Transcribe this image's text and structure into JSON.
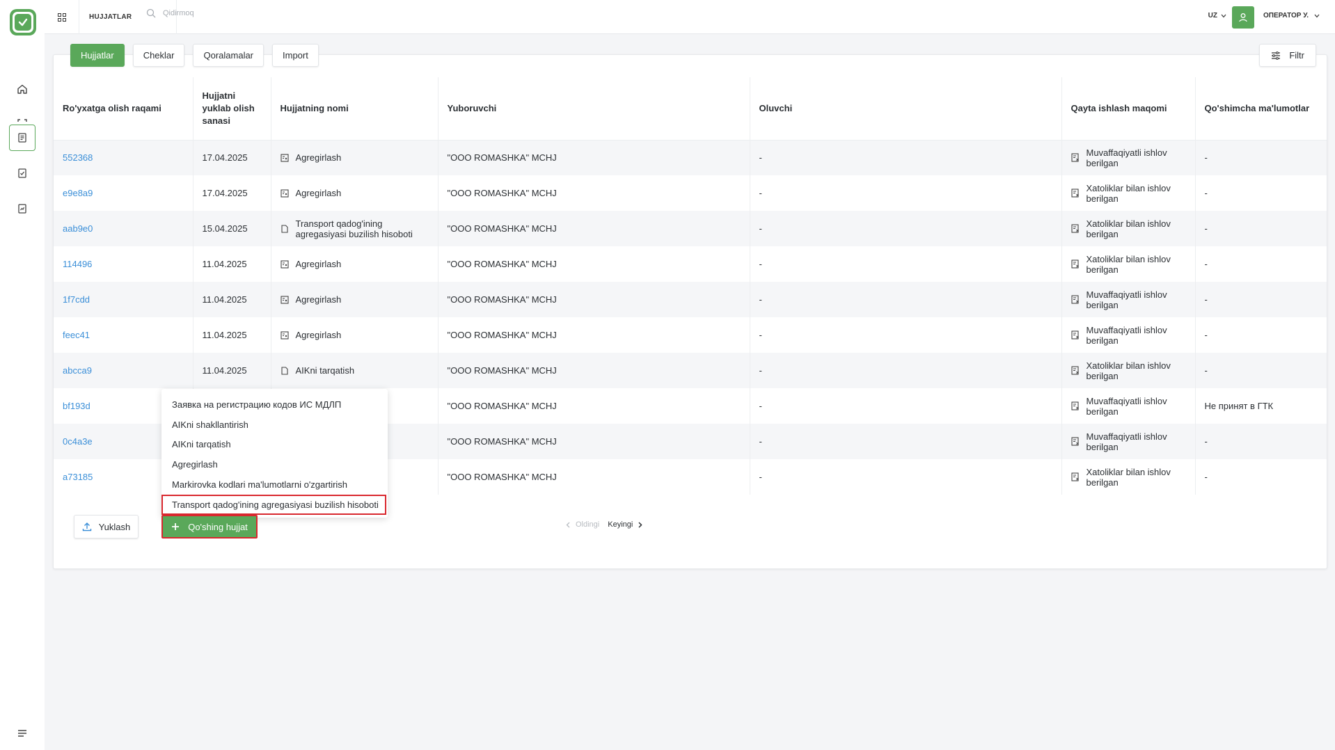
{
  "topbar": {
    "section_title": "HUJJATLAR",
    "search_placeholder": "Qidirmoq",
    "language": "UZ",
    "user_name": "ОПЕРАТОР У."
  },
  "tabs": [
    {
      "label": "Hujjatlar",
      "active": true
    },
    {
      "label": "Cheklar",
      "active": false
    },
    {
      "label": "Qoralamalar",
      "active": false
    },
    {
      "label": "Import",
      "active": false
    }
  ],
  "filter_label": "Filtr",
  "table": {
    "headers": [
      "Ro'yxatga olish raqami",
      "Hujjatni yuklab olish sanasi",
      "Hujjatning nomi",
      "Yuboruvchi",
      "Oluvchi",
      "Qayta ishlash maqomi",
      "Qo'shimcha ma'lumotlar"
    ],
    "rows": [
      {
        "id": "552368",
        "date": "17.04.2025",
        "name": "Agregirlash",
        "sender": "\"OOO ROMASHKA\" MCHJ",
        "receiver": "-",
        "status": "Muvaffaqiyatli ishlov berilgan",
        "extra": "-"
      },
      {
        "id": "e9e8a9",
        "date": "17.04.2025",
        "name": "Agregirlash",
        "sender": "\"OOO ROMASHKA\" MCHJ",
        "receiver": "-",
        "status": "Xatoliklar bilan ishlov berilgan",
        "extra": "-"
      },
      {
        "id": "aab9e0",
        "date": "15.04.2025",
        "name": "Transport qadog'ining agregasiyasi buzilish hisoboti",
        "sender": "\"OOO ROMASHKA\" MCHJ",
        "receiver": "-",
        "status": "Xatoliklar bilan ishlov berilgan",
        "extra": "-"
      },
      {
        "id": "114496",
        "date": "11.04.2025",
        "name": "Agregirlash",
        "sender": "\"OOO ROMASHKA\" MCHJ",
        "receiver": "-",
        "status": "Xatoliklar bilan ishlov berilgan",
        "extra": "-"
      },
      {
        "id": "1f7cdd",
        "date": "11.04.2025",
        "name": "Agregirlash",
        "sender": "\"OOO ROMASHKA\" MCHJ",
        "receiver": "-",
        "status": "Muvaffaqiyatli ishlov berilgan",
        "extra": "-"
      },
      {
        "id": "feec41",
        "date": "11.04.2025",
        "name": "Agregirlash",
        "sender": "\"OOO ROMASHKA\" MCHJ",
        "receiver": "-",
        "status": "Muvaffaqiyatli ishlov berilgan",
        "extra": "-"
      },
      {
        "id": "abcca9",
        "date": "11.04.2025",
        "name": "AIKni tarqatish",
        "sender": "\"OOO ROMASHKA\" MCHJ",
        "receiver": "-",
        "status": "Xatoliklar bilan ishlov berilgan",
        "extra": "-"
      },
      {
        "id": "bf193d",
        "date": "",
        "name": "",
        "sender": "\"OOO ROMASHKA\" MCHJ",
        "receiver": "-",
        "status": "Muvaffaqiyatli ishlov berilgan",
        "extra": "Не принят в ГТК"
      },
      {
        "id": "0c4a3e",
        "date": "",
        "name": "",
        "sender": "\"OOO ROMASHKA\" MCHJ",
        "receiver": "-",
        "status": "Muvaffaqiyatli ishlov berilgan",
        "extra": "-"
      },
      {
        "id": "a73185",
        "date": "",
        "name": "",
        "sender": "\"OOO ROMASHKA\" MCHJ",
        "receiver": "-",
        "status": "Xatoliklar bilan ishlov berilgan",
        "extra": "-"
      }
    ]
  },
  "dropdown": {
    "items": [
      "Заявка на регистрацию кодов ИС МДЛП",
      "AIKni shakllantirish",
      "AIKni tarqatish",
      "Agregirlash",
      "Markirovka kodlari ma'lumotlarni o'zgartirish",
      "Transport qadog'ining agregasiyasi buzilish hisoboti"
    ],
    "highlighted_index": 5
  },
  "actions": {
    "upload_label": "Yuklash",
    "add_label": "Qo'shing hujjat"
  },
  "pagination": {
    "prev_label": "Oldingi",
    "next_label": "Keyingi"
  },
  "colors": {
    "brand": "#5aa85a",
    "link": "#3b8fd8",
    "highlight": "#d9272e"
  }
}
